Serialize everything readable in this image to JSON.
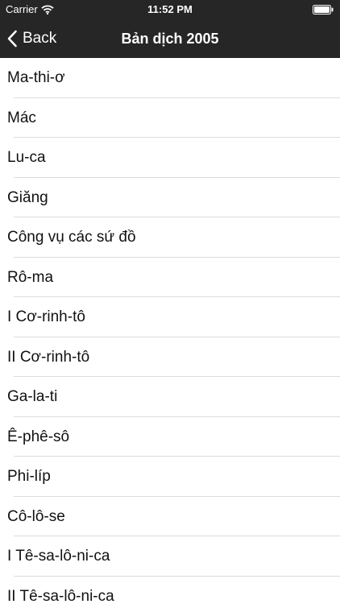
{
  "status_bar": {
    "carrier": "Carrier",
    "time": "11:52 PM",
    "icons": [
      "wifi-icon",
      "battery-icon"
    ]
  },
  "nav": {
    "back_label": "Back",
    "title": "Bản dịch 2005",
    "back_icon": "chevron-left-icon"
  },
  "colors": {
    "header_bg": "#262626",
    "header_text": "#ffffff",
    "list_bg": "#ffffff",
    "separator": "#dcdcdc",
    "item_text": "#111111"
  },
  "books": [
    "Ma-thi-ơ",
    "Mác",
    "Lu-ca",
    "Giăng",
    "Công vụ các sứ đồ",
    "Rô-ma",
    "I Cơ-rinh-tô",
    "II Cơ-rinh-tô",
    "Ga-la-ti",
    "Ê-phê-sô",
    "Phi-líp",
    "Cô-lô-se",
    "I Tê-sa-lô-ni-ca",
    "II Tê-sa-lô-ni-ca"
  ]
}
